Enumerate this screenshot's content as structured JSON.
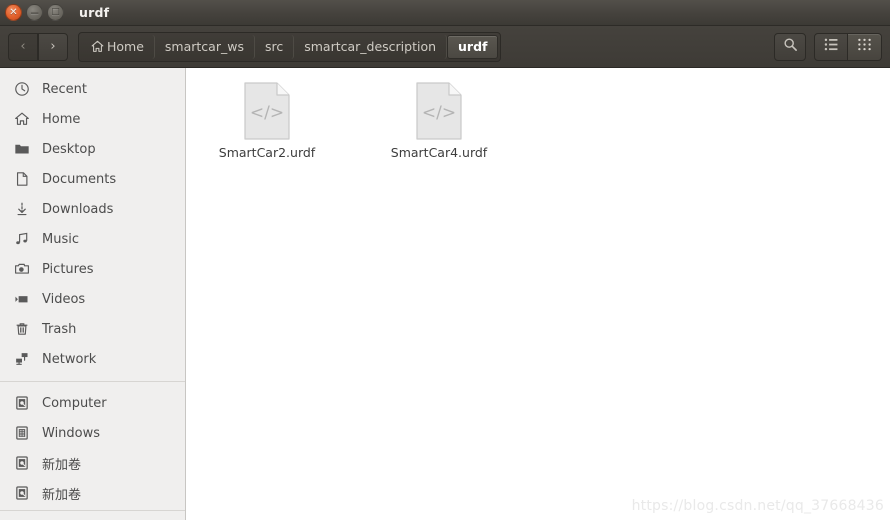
{
  "window": {
    "title": "urdf",
    "controls": [
      {
        "name": "close",
        "glyph": "✕"
      },
      {
        "name": "minimize",
        "glyph": "−"
      },
      {
        "name": "maximize",
        "glyph": "□"
      }
    ]
  },
  "toolbar": {
    "back_label": "‹",
    "forward_label": "›",
    "search_label": "search-icon",
    "view_list_label": "list-view-icon",
    "view_grid_label": "grid-view-icon",
    "breadcrumbs": [
      {
        "label": "Home",
        "icon": "home-icon",
        "active": false
      },
      {
        "label": "smartcar_ws",
        "icon": "",
        "active": false
      },
      {
        "label": "src",
        "icon": "",
        "active": false
      },
      {
        "label": "smartcar_description",
        "icon": "",
        "active": false
      },
      {
        "label": "urdf",
        "icon": "",
        "active": true
      }
    ]
  },
  "sidebar": {
    "groups": [
      {
        "items": [
          {
            "label": "Recent",
            "icon": "clock-icon"
          },
          {
            "label": "Home",
            "icon": "home-icon"
          },
          {
            "label": "Desktop",
            "icon": "folder-icon"
          },
          {
            "label": "Documents",
            "icon": "document-icon"
          },
          {
            "label": "Downloads",
            "icon": "download-icon"
          },
          {
            "label": "Music",
            "icon": "music-note-icon"
          },
          {
            "label": "Pictures",
            "icon": "camera-icon"
          },
          {
            "label": "Videos",
            "icon": "video-camera-icon"
          },
          {
            "label": "Trash",
            "icon": "trash-icon"
          },
          {
            "label": "Network",
            "icon": "network-icon"
          }
        ]
      },
      {
        "items": [
          {
            "label": "Computer",
            "icon": "harddisk-icon"
          },
          {
            "label": "Windows",
            "icon": "windows-drive-icon"
          },
          {
            "label": "新加卷",
            "icon": "harddisk-icon"
          },
          {
            "label": "新加卷",
            "icon": "harddisk-icon"
          }
        ]
      }
    ]
  },
  "content": {
    "files": [
      {
        "name": "SmartCar2.urdf",
        "icon": "code-file-icon"
      },
      {
        "name": "SmartCar4.urdf",
        "icon": "code-file-icon"
      }
    ],
    "watermark": "https://blog.csdn.net/qq_37668436"
  },
  "colors": {
    "titlebar": "#45423d",
    "toolbar": "#3e3b36",
    "sidebar": "#f0efee",
    "content": "#ffffff",
    "close_button": "#e2612c",
    "text_light": "#cfcbc4",
    "text_dark": "#4c4c4c"
  }
}
